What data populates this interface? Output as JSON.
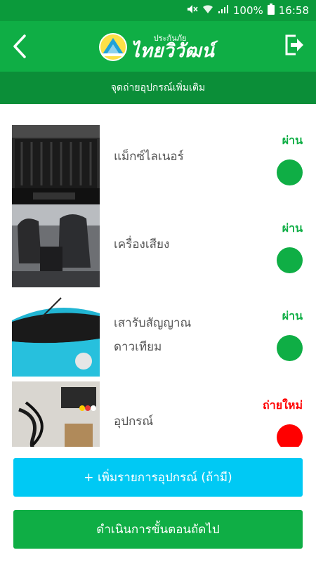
{
  "status_bar": {
    "battery": "100%",
    "time": "16:58",
    "icons": [
      "mute-icon",
      "wifi-icon",
      "signal-icon",
      "battery-icon"
    ]
  },
  "header": {
    "logo_small": "ประกันภัย",
    "logo_big": "ไทยวิวัฒน์",
    "back_icon": "chevron-left-icon",
    "logout_icon": "logout-icon"
  },
  "subheader": {
    "title": "จุดถ่ายอุปกรณ์เพิ่มเติม"
  },
  "items": [
    {
      "label": "แม็กซ์ไลเนอร์",
      "status": "ผ่าน",
      "status_color": "#0fae45",
      "image": "truck-bed-liner"
    },
    {
      "label": "เครื่องเสียง",
      "status": "ผ่าน",
      "status_color": "#0fae45",
      "image": "car-interior-seats"
    },
    {
      "label": "เสารับสัญญาณ",
      "label2": "ดาวเทียม",
      "status": "ผ่าน",
      "status_color": "#0fae45",
      "image": "car-antenna"
    },
    {
      "label": "อุปกรณ์",
      "status": "ถ่ายใหม่",
      "status_color": "#ff0000",
      "image": "device-cables"
    }
  ],
  "buttons": {
    "add_label": "+ เพิ่มรายการอุปกรณ์ (ถ้ามี)",
    "next_label": "ดำเนินการขั้นตอนถัดไป"
  },
  "colors": {
    "primary": "#0fae45",
    "dark": "#0b8e38",
    "accent": "#00c9f4",
    "fail": "#ff0000"
  }
}
